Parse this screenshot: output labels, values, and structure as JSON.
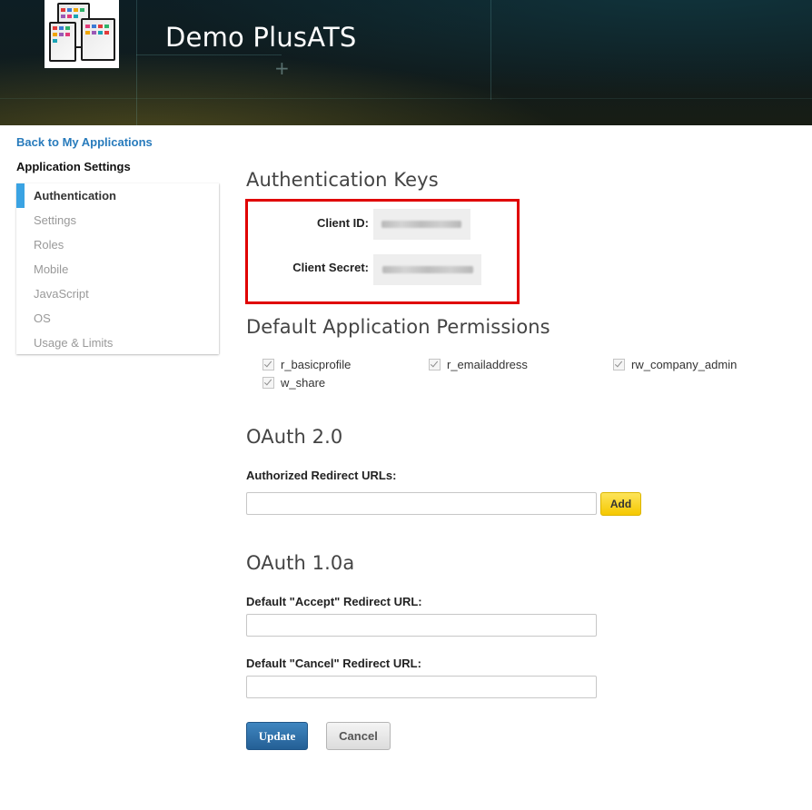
{
  "app": {
    "title": "Demo PlusATS",
    "logo": "app-device-screens-logo"
  },
  "sidebar": {
    "back_link": "Back to My Applications",
    "heading": "Application Settings",
    "items": [
      {
        "label": "Authentication",
        "active": true
      },
      {
        "label": "Settings",
        "active": false
      },
      {
        "label": "Roles",
        "active": false
      },
      {
        "label": "Mobile",
        "active": false
      },
      {
        "label": "JavaScript",
        "active": false
      },
      {
        "label": "OS",
        "active": false
      },
      {
        "label": "Usage & Limits",
        "active": false
      }
    ]
  },
  "auth_keys": {
    "title": "Authentication Keys",
    "client_id_label": "Client ID:",
    "client_secret_label": "Client Secret:",
    "values_redacted": true
  },
  "permissions": {
    "title": "Default Application Permissions",
    "items": [
      {
        "label": "r_basicprofile",
        "checked": true
      },
      {
        "label": "r_emailaddress",
        "checked": true
      },
      {
        "label": "rw_company_admin",
        "checked": true
      },
      {
        "label": "w_share",
        "checked": true
      }
    ]
  },
  "oauth2": {
    "title": "OAuth 2.0",
    "redirect_label": "Authorized Redirect URLs:",
    "redirect_value": "",
    "add_label": "Add"
  },
  "oauth1": {
    "title": "OAuth 1.0a",
    "accept_label": "Default \"Accept\" Redirect URL:",
    "accept_value": "",
    "cancel_label": "Default \"Cancel\" Redirect URL:",
    "cancel_value": ""
  },
  "actions": {
    "update_label": "Update",
    "cancel_label": "Cancel"
  },
  "colors": {
    "link": "#287bbc",
    "active_indicator": "#3aa3e3",
    "highlight_box": "#e00000",
    "add_button": "#f5c800",
    "update_button": "#2d6da6"
  }
}
